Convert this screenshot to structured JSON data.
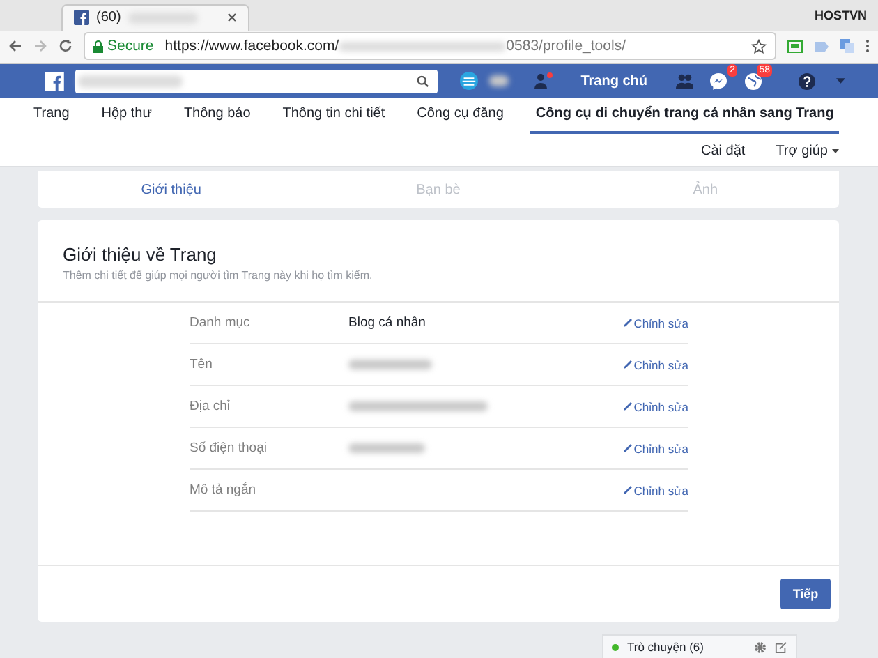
{
  "browser": {
    "tab_title": "(60)",
    "account": "HOSTVN",
    "secure": "Secure",
    "url_start": "https://www.facebook.com/",
    "url_end": "0583/profile_tools/"
  },
  "topbar": {
    "home": "Trang chủ",
    "badges": [
      "2",
      "58"
    ]
  },
  "nav_tabs": [
    {
      "label": "Trang",
      "selected": false
    },
    {
      "label": "Hộp thư",
      "selected": false
    },
    {
      "label": "Thông báo",
      "selected": false
    },
    {
      "label": "Thông tin chi tiết",
      "selected": false
    },
    {
      "label": "Công cụ đăng",
      "selected": false
    },
    {
      "label": "Công cụ di chuyển trang cá nhân sang Trang",
      "selected": true
    }
  ],
  "sub_links": [
    "Cài đặt",
    "Trợ giúp"
  ],
  "steps": [
    {
      "label": "Giới thiệu",
      "selected": true
    },
    {
      "label": "Bạn bè",
      "selected": false
    },
    {
      "label": "Ảnh",
      "selected": false
    }
  ],
  "section": {
    "title": "Giới thiệu về Trang",
    "subtitle": "Thêm chi tiết để giúp mọi người tìm Trang này khi họ tìm kiếm.",
    "rows": [
      {
        "label": "Danh mục",
        "kind": "text",
        "value": "Blog cá nhân",
        "edit": "Chỉnh sửa"
      },
      {
        "label": "Tên",
        "kind": "blurred",
        "edit": "Chỉnh sửa"
      },
      {
        "label": "Địa chỉ",
        "kind": "blurred",
        "edit": "Chỉnh sửa"
      },
      {
        "label": "Số điện thoại",
        "kind": "blurred",
        "edit": "Chỉnh sửa"
      },
      {
        "label": "Mô tả ngắn",
        "kind": "empty",
        "edit": "Chỉnh sửa"
      }
    ]
  },
  "next_button": "Tiếp",
  "chat": "Trò chuyện (6)"
}
